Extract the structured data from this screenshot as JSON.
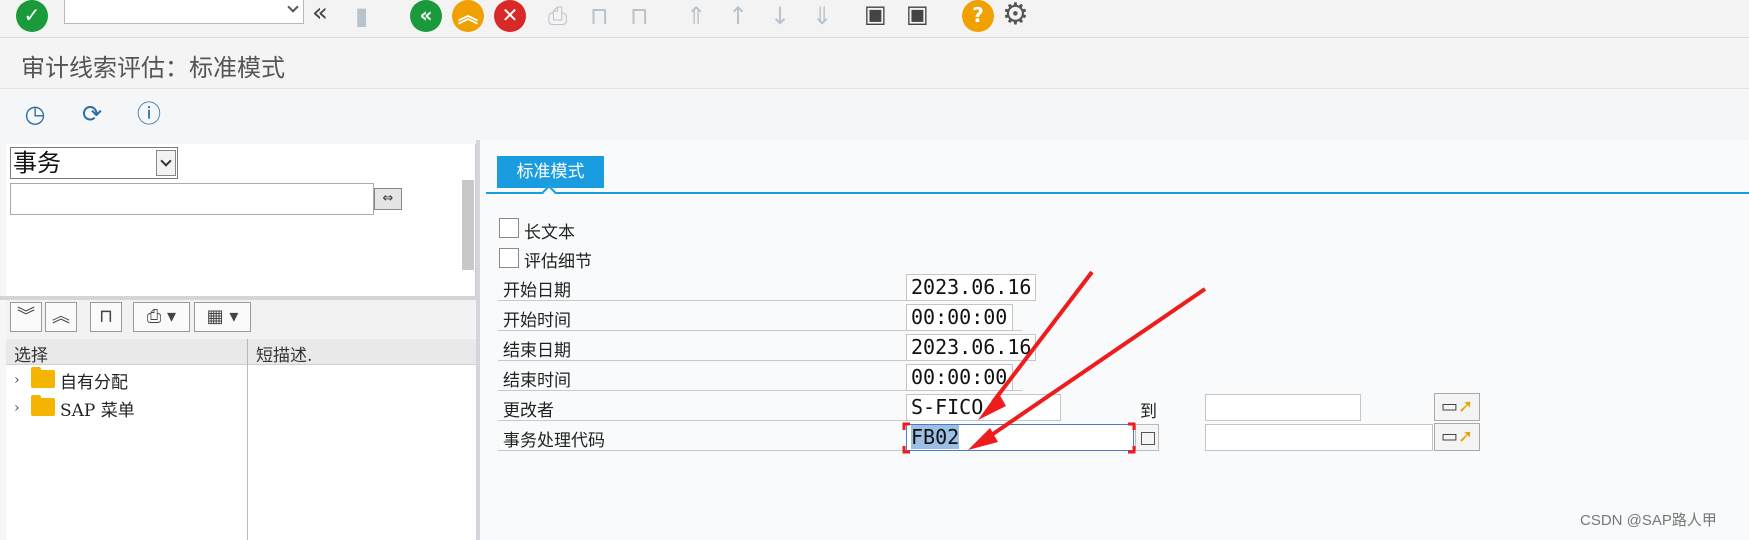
{
  "toolbar": {
    "command_field_value": "",
    "icons": [
      "enter-check-icon",
      "back-double-chevron-icon",
      "save-icon",
      "back-green-icon",
      "exit-yellow-icon",
      "cancel-red-icon",
      "print-icon",
      "find-icon",
      "find-next-icon",
      "first-page-icon",
      "previous-page-icon",
      "next-page-icon",
      "last-page-icon",
      "create-session-icon",
      "shortcut-icon",
      "help-icon",
      "settings-gear-icon"
    ]
  },
  "title": "审计线索评估：标准模式",
  "app_toolbar": {
    "icons": [
      "execute-icon",
      "refresh-icon",
      "info-icon"
    ]
  },
  "left": {
    "combo_value": "事务",
    "search_value": "",
    "search_button": "⇔",
    "tree_columns": [
      "选择",
      "短描述."
    ],
    "tree_rows": [
      {
        "label": "自有分配"
      },
      {
        "label": "SAP 菜单"
      }
    ]
  },
  "right": {
    "tab_label": "标准模式",
    "checkboxes": [
      {
        "label": "长文本",
        "checked": false
      },
      {
        "label": "评估细节",
        "checked": false
      }
    ],
    "fields": [
      {
        "label": "开始日期",
        "value": "2023.06.16"
      },
      {
        "label": "开始时间",
        "value": "00:00:00"
      },
      {
        "label": "结束日期",
        "value": "2023.06.16"
      },
      {
        "label": "结束时间",
        "value": "00:00:00"
      },
      {
        "label": "更改者",
        "value": "S-FICO",
        "to_label": "到",
        "to_value": ""
      },
      {
        "label": "事务处理代码",
        "value": "FB02",
        "to_value": ""
      }
    ]
  },
  "colors": {
    "tab_blue": "#1a9de0",
    "accept_green": "#1a9a3a",
    "exit_yellow": "#f0a000",
    "cancel_red": "#d92828",
    "folder_yellow": "#f4b400",
    "annotation_red": "#ee1c1c"
  },
  "watermark": "CSDN @SAP路人甲"
}
